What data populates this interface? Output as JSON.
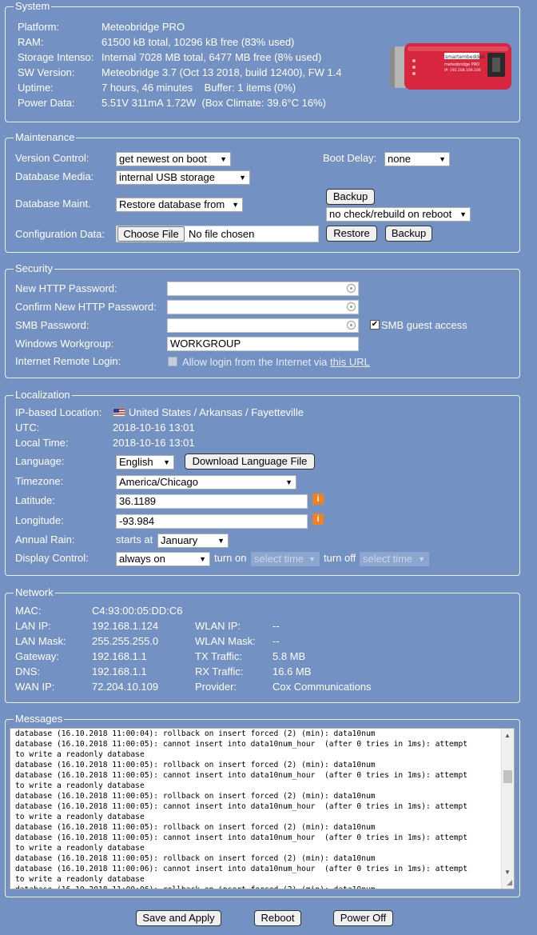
{
  "system": {
    "title": "System",
    "rows": [
      {
        "label": "Platform:",
        "value": "Meteobridge PRO"
      },
      {
        "label": "RAM:",
        "value": "61500 kB total, 10296 kB free (83% used)"
      },
      {
        "label": "Storage Intenso:",
        "value": "Internal 7028 MB total, 6477 MB free (8% used)"
      },
      {
        "label": "SW Version:",
        "value": "Meteobridge 3.7 (Oct 13 2018, build 12400), FW 1.4"
      },
      {
        "label": "Uptime:",
        "value": "7 hours, 46 minutes    Buffer: 1 items (0%)"
      },
      {
        "label": "Power Data:",
        "value": "5.51V 311mA 1.72W  (Box Climate: 39.6°C 16%)"
      }
    ],
    "device": {
      "brand": "smartembedded",
      "model": "meteobridge PRO",
      "ip": "IP: 192.168.100.100"
    }
  },
  "maintenance": {
    "title": "Maintenance",
    "version_control_label": "Version Control:",
    "version_control_value": "get newest on boot",
    "boot_delay_label": "Boot Delay:",
    "boot_delay_value": "none",
    "db_media_label": "Database Media:",
    "db_media_value": "internal USB storage",
    "db_maint_label": "Database Maint.",
    "db_maint_value": "Restore database from",
    "db_backup_button": "Backup",
    "db_check_value": "no check/rebuild on reboot",
    "config_label": "Configuration Data:",
    "choose_file_button": "Choose File",
    "no_file_text": "No file chosen",
    "restore_button": "Restore",
    "config_backup_button": "Backup"
  },
  "security": {
    "title": "Security",
    "new_pw_label": "New HTTP Password:",
    "confirm_pw_label": "Confirm New HTTP Password:",
    "smb_pw_label": "SMB Password:",
    "smb_guest_label": "SMB guest access",
    "workgroup_label": "Windows Workgroup:",
    "workgroup_value": "WORKGROUP",
    "remote_login_label": "Internet Remote Login:",
    "remote_login_text": "Allow login from the Internet via",
    "remote_login_link": "this URL"
  },
  "localization": {
    "title": "Localization",
    "ip_location_label": "IP-based Location:",
    "ip_location_value": "United States / Arkansas / Fayetteville",
    "utc_label": "UTC:",
    "utc_value": "2018-10-16 13:01",
    "local_time_label": "Local Time:",
    "local_time_value": "2018-10-16 13:01",
    "language_label": "Language:",
    "language_value": "English",
    "download_lang_button": "Download Language File",
    "timezone_label": "Timezone:",
    "timezone_value": "America/Chicago",
    "latitude_label": "Latitude:",
    "latitude_value": "36.1189",
    "longitude_label": "Longitude:",
    "longitude_value": "-93.984",
    "annual_rain_label": "Annual Rain:",
    "starts_at_text": "starts at",
    "rain_month_value": "January",
    "display_label": "Display Control:",
    "display_value": "always on",
    "turn_on_text": "turn on",
    "turn_on_value": "select time",
    "turn_off_text": "turn off",
    "turn_off_value": "select time"
  },
  "network": {
    "title": "Network",
    "mac_label": "MAC:",
    "mac_value": "C4:93:00:05:DD:C6",
    "lan_ip_label": "LAN IP:",
    "lan_ip_value": "192.168.1.124",
    "wlan_ip_label": "WLAN IP:",
    "wlan_ip_value": "--",
    "lan_mask_label": "LAN Mask:",
    "lan_mask_value": "255.255.255.0",
    "wlan_mask_label": "WLAN Mask:",
    "wlan_mask_value": "--",
    "gateway_label": "Gateway:",
    "gateway_value": "192.168.1.1",
    "tx_label": "TX Traffic:",
    "tx_value": "5.8 MB",
    "dns_label": "DNS:",
    "dns_value": "192.168.1.1",
    "rx_label": "RX Traffic:",
    "rx_value": "16.6 MB",
    "wan_ip_label": "WAN IP:",
    "wan_ip_value": "72.204.10.109",
    "provider_label": "Provider:",
    "provider_value": "Cox Communications"
  },
  "messages": {
    "title": "Messages",
    "log": "database (16.10.2018 11:00:04): rollback on insert forced (2) (min): data10num\ndatabase (16.10.2018 11:00:05): cannot insert into data10num_hour  (after 0 tries in 1ms): attempt\nto write a readonly database\ndatabase (16.10.2018 11:00:05): rollback on insert forced (2) (min): data10num\ndatabase (16.10.2018 11:00:05): cannot insert into data10num_hour  (after 0 tries in 1ms): attempt\nto write a readonly database\ndatabase (16.10.2018 11:00:05): rollback on insert forced (2) (min): data10num\ndatabase (16.10.2018 11:00:05): cannot insert into data10num_hour  (after 0 tries in 1ms): attempt\nto write a readonly database\ndatabase (16.10.2018 11:00:05): rollback on insert forced (2) (min): data10num\ndatabase (16.10.2018 11:00:05): cannot insert into data10num_hour  (after 0 tries in 1ms): attempt\nto write a readonly database\ndatabase (16.10.2018 11:00:05): rollback on insert forced (2) (min): data10num\ndatabase (16.10.2018 11:00:06): cannot insert into data10num_hour  (after 0 tries in 1ms): attempt\nto write a readonly database\ndatabase (16.10.2018 11:00:06): rollback on insert forced (2) (min): data10num"
  },
  "footer": {
    "save_button": "Save and Apply",
    "reboot_button": "Reboot",
    "power_off_button": "Power Off"
  }
}
